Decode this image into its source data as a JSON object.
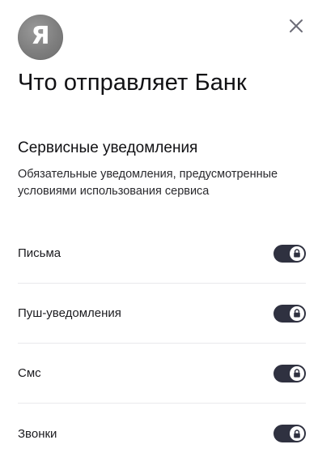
{
  "logo": {
    "letter": "Я",
    "icon": "yandex-logo"
  },
  "header": {
    "close_icon": "close-icon"
  },
  "title": "Что отправляет Банк",
  "section": {
    "title": "Сервисные уведомления",
    "description": "Обязательные уведомления, предусмотренные условиями использования сервиса"
  },
  "notifications": [
    {
      "label": "Письма",
      "enabled": true,
      "locked": true
    },
    {
      "label": "Пуш-уведомления",
      "enabled": true,
      "locked": true
    },
    {
      "label": "Смс",
      "enabled": true,
      "locked": true
    },
    {
      "label": "Звонки",
      "enabled": true,
      "locked": true
    }
  ],
  "colors": {
    "toggle_on": "#2f3140",
    "logo_bg": "#7e7e7e",
    "divider": "#e9e9ec"
  }
}
